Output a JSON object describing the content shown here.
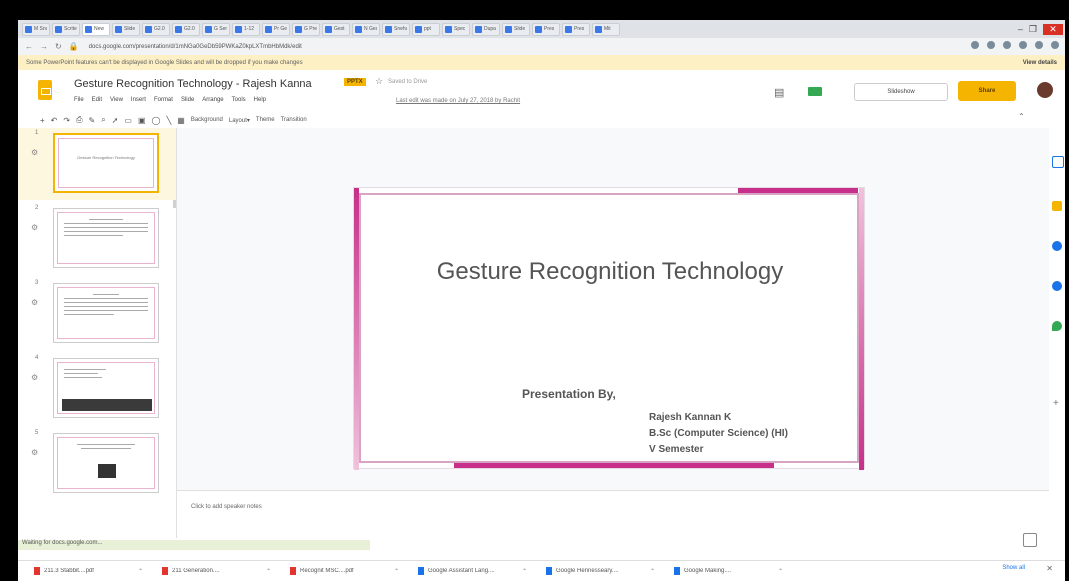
{
  "browser": {
    "tabs": [
      "M Sns",
      "Scrite",
      "New",
      "Slide",
      "G2.0",
      "G2.0",
      "G Serv",
      "1-12",
      "Pr Gest",
      "G Pres",
      "Gest",
      "N Gest",
      "Sneha",
      "ppt",
      "Spec",
      "Dupa",
      "Slide",
      "Pres",
      "Pres",
      "Mit"
    ],
    "active_tab_index": 2,
    "url": "docs.google.com/presentation/d/1mNGa0GeDb59PWKaZ0kpLXTmbHbMdk/edit",
    "window_controls": {
      "minimize": "–",
      "maximize": "❐",
      "close": "✕"
    }
  },
  "warning": {
    "text": "Some PowerPoint features can't be displayed in Google Slides and will be dropped if you make changes",
    "details": "View details"
  },
  "app": {
    "title": "Gesture Recognition Technology - Rajesh Kanna",
    "badge": "PPTX",
    "saved": "Saved to Drive",
    "menus": [
      "File",
      "Edit",
      "View",
      "Insert",
      "Format",
      "Slide",
      "Arrange",
      "Tools",
      "Help"
    ],
    "last_edit": "Last edit was made on July 27, 2018 by Rachit",
    "slideshow_label": "Slideshow",
    "share_label": "Share"
  },
  "toolbar": {
    "items": [
      "Background",
      "Layout▾",
      "Theme",
      "Transition"
    ]
  },
  "filmstrip": {
    "slides": [
      {
        "num": "1",
        "text": "Gesture Recognition Technology"
      },
      {
        "num": "2",
        "text": ""
      },
      {
        "num": "3",
        "text": ""
      },
      {
        "num": "4",
        "text": ""
      },
      {
        "num": "5",
        "text": ""
      }
    ]
  },
  "slide": {
    "title": "Gesture Recognition Technology",
    "presented_by": "Presentation By,",
    "author_lines": [
      "Rajesh Kannan K",
      "B.Sc (Computer Science) (HI)",
      "V Semester"
    ]
  },
  "notes": {
    "placeholder": "Click to add speaker notes"
  },
  "status_url": "Waiting for docs.google.com...",
  "downloads": {
    "items": [
      {
        "name": "211.3 Stabbit....pdf",
        "type": "pdf"
      },
      {
        "name": "211 Generation....",
        "type": "pdf"
      },
      {
        "name": "Recognit MSC....pdf",
        "type": "pdf"
      },
      {
        "name": "Google Assistant Lang....",
        "type": "doc"
      },
      {
        "name": "Google Hennesseary....",
        "type": "doc"
      },
      {
        "name": "Google Making....",
        "type": "doc"
      }
    ],
    "show_all": "Show all"
  },
  "colors": {
    "accent": "#f4b400",
    "slide_accent": "#c6308a"
  }
}
